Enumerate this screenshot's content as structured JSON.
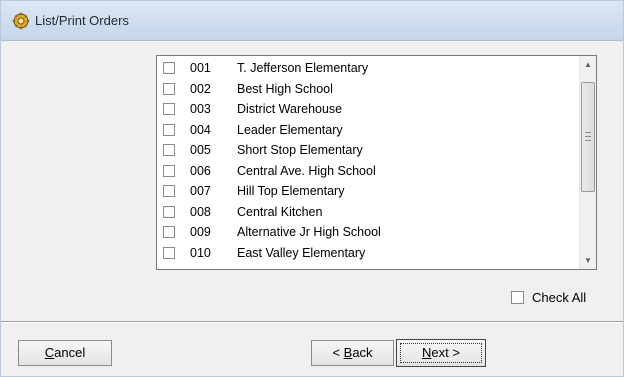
{
  "window": {
    "title": "List/Print Orders",
    "icon": "app-gear-icon"
  },
  "locations": [
    {
      "code": "001",
      "name": "T. Jefferson Elementary",
      "checked": false
    },
    {
      "code": "002",
      "name": "Best High School",
      "checked": false
    },
    {
      "code": "003",
      "name": "District Warehouse",
      "checked": false
    },
    {
      "code": "004",
      "name": "Leader Elementary",
      "checked": false
    },
    {
      "code": "005",
      "name": "Short Stop Elementary",
      "checked": false
    },
    {
      "code": "006",
      "name": "Central Ave. High School",
      "checked": false
    },
    {
      "code": "007",
      "name": "Hill Top Elementary",
      "checked": false
    },
    {
      "code": "008",
      "name": "Central Kitchen",
      "checked": false
    },
    {
      "code": "009",
      "name": "Alternative Jr High School",
      "checked": false
    },
    {
      "code": "010",
      "name": "East Valley Elementary",
      "checked": false
    }
  ],
  "check_all": {
    "label": "Check All",
    "checked": false
  },
  "buttons": {
    "cancel": {
      "accel": "C",
      "rest": "ancel"
    },
    "back": {
      "prefix": "< ",
      "accel": "B",
      "rest": "ack"
    },
    "next": {
      "accel": "N",
      "rest": "ext >"
    }
  }
}
